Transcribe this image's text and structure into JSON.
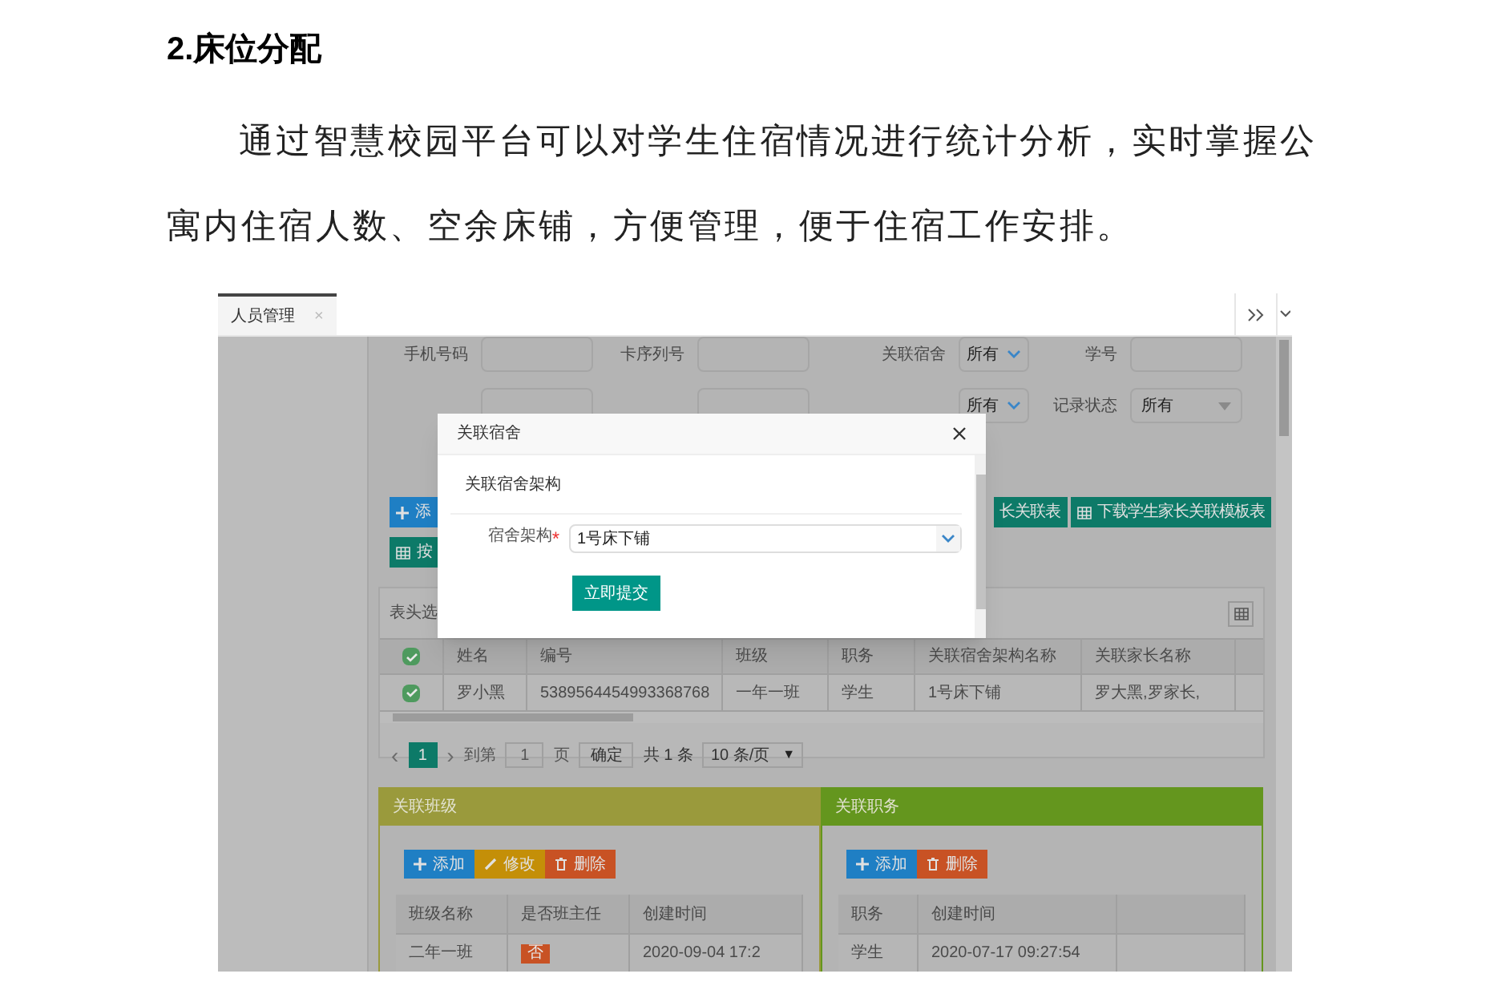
{
  "doc": {
    "heading": "2.床位分配",
    "paragraph": "通过智慧校园平台可以对学生住宿情况进行统计分析，实时掌握公寓内住宿人数、空余床铺，方便管理，便于住宿工作安排。"
  },
  "screen": {
    "tabs": [
      {
        "label": "人员管理",
        "selected": true,
        "close": "×"
      }
    ],
    "filters": [
      {
        "label": "手机号码",
        "kind": "input"
      },
      {
        "label": "卡序列号",
        "kind": "input"
      },
      {
        "label": "关联宿舍",
        "kind": "select",
        "value": "所有"
      },
      {
        "label": "学号",
        "kind": "input"
      }
    ],
    "filters_row2": [
      {
        "kind": "input"
      },
      {
        "kind": "input"
      },
      {
        "kind": "select",
        "value": "所有"
      },
      {
        "label": "记录状态",
        "kind": "dropdown",
        "value": "所有"
      }
    ],
    "left_buttons": [
      {
        "label": "添",
        "kind": "add"
      },
      {
        "label": "按",
        "kind": "grid"
      }
    ],
    "right_buttons": [
      {
        "label": "长关联表",
        "kind": "plain"
      },
      {
        "label": "下载学生家长关联模板表",
        "kind": "grid"
      }
    ],
    "table": {
      "toolbar_label": "表头选",
      "header_checked": true,
      "columns": [
        "姓名",
        "编号",
        "班级",
        "职务",
        "关联宿舍架构名称",
        "关联家长名称"
      ],
      "rows": [
        {
          "checked": true,
          "cells": [
            "罗小黑",
            "5389564454993368768",
            "一年一班",
            "学生",
            "1号床下铺",
            "罗大黑,罗家长,"
          ]
        }
      ]
    },
    "pagination": {
      "prev": "‹",
      "next": "›",
      "current": "1",
      "goto_label": "到第",
      "page_input": "1",
      "page_unit": "页",
      "confirm": "确定",
      "total": "共 1 条",
      "page_size": "10 条/页",
      "caret": "▼"
    },
    "panels": [
      {
        "title": "关联班级",
        "color": "#9a9a3c",
        "buttons": [
          {
            "label": "添加",
            "kind": "add"
          },
          {
            "label": "修改",
            "kind": "edit"
          },
          {
            "label": "删除",
            "kind": "delete"
          }
        ],
        "columns": [
          "班级名称",
          "是否班主任",
          "创建时间"
        ],
        "rows": [
          [
            {
              "kind": "text",
              "text": "二年一班"
            },
            {
              "kind": "badge",
              "text": "否"
            },
            {
              "kind": "text",
              "text": "2020-09-04 17:2"
            }
          ]
        ]
      },
      {
        "title": "关联职务",
        "color": "#64961e",
        "buttons": [
          {
            "label": "添加",
            "kind": "add"
          },
          {
            "label": "删除",
            "kind": "delete"
          }
        ],
        "columns": [
          "职务",
          "创建时间",
          ""
        ],
        "rows": [
          [
            {
              "kind": "text",
              "text": "学生"
            },
            {
              "kind": "text",
              "text": "2020-07-17 09:27:54"
            },
            {
              "kind": "text",
              "text": ""
            }
          ]
        ]
      }
    ],
    "modal": {
      "title": "关联宿舍",
      "section": "关联宿舍架构",
      "field_label": "宿舍架构",
      "required_mark": "*",
      "value": "1号床下铺",
      "submit": "立即提交"
    }
  }
}
